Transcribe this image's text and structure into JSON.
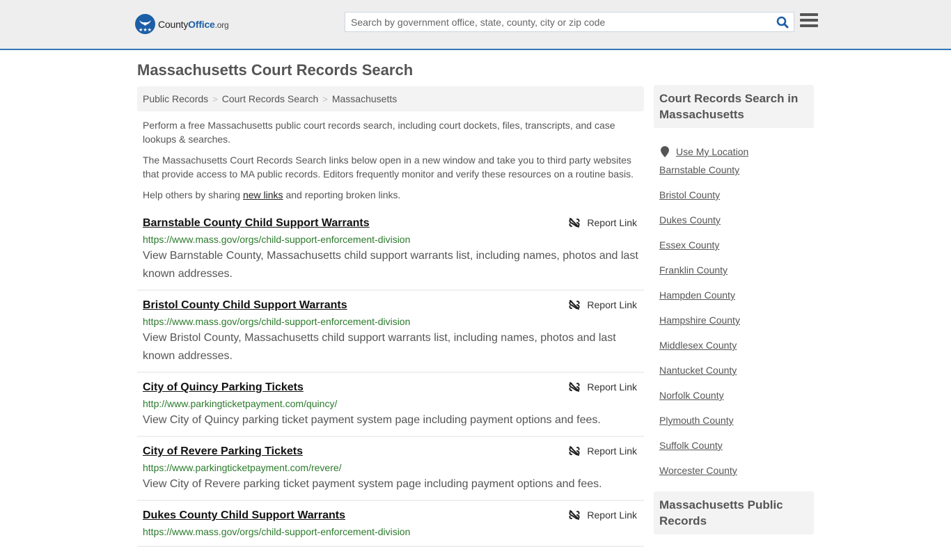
{
  "header": {
    "logo": {
      "county": "County",
      "office": "Office",
      "org": ".org"
    },
    "search": {
      "placeholder": "Search by government office, state, county, city or zip code",
      "value": ""
    },
    "colors": {
      "brand": "#1c5ea6",
      "accent_border": "#3278b6",
      "url_green": "#2b7a2b"
    }
  },
  "page": {
    "title": "Massachusetts Court Records Search"
  },
  "breadcrumb": [
    {
      "label": "Public Records"
    },
    {
      "label": "Court Records Search"
    },
    {
      "label": "Massachusetts"
    }
  ],
  "breadcrumb_separator": ">",
  "intro": {
    "p1": "Perform a free Massachusetts public court records search, including court dockets, files, transcripts, and case lookups & searches.",
    "p2": "The Massachusetts Court Records Search links below open in a new window and take you to third party websites that provide access to MA public records. Editors frequently monitor and verify these resources on a routine basis.",
    "p3_before": "Help others by sharing ",
    "p3_link": "new links",
    "p3_after": " and reporting broken links."
  },
  "report_label": "Report Link",
  "results": [
    {
      "title": "Barnstable County Child Support Warrants",
      "url": "https://www.mass.gov/orgs/child-support-enforcement-division",
      "desc": "View Barnstable County, Massachusetts child support warrants list, including names, photos and last known addresses."
    },
    {
      "title": "Bristol County Child Support Warrants",
      "url": "https://www.mass.gov/orgs/child-support-enforcement-division",
      "desc": "View Bristol County, Massachusetts child support warrants list, including names, photos and last known addresses."
    },
    {
      "title": "City of Quincy Parking Tickets",
      "url": "http://www.parkingticketpayment.com/quincy/",
      "desc": "View City of Quincy parking ticket payment system page including payment options and fees."
    },
    {
      "title": "City of Revere Parking Tickets",
      "url": "https://www.parkingticketpayment.com/revere/",
      "desc": "View City of Revere parking ticket payment system page including payment options and fees."
    },
    {
      "title": "Dukes County Child Support Warrants",
      "url": "https://www.mass.gov/orgs/child-support-enforcement-division",
      "desc": ""
    }
  ],
  "sidebar": {
    "heading1": "Court Records Search in Massachusetts",
    "use_location": "Use My Location",
    "counties": [
      "Barnstable County",
      "Bristol County",
      "Dukes County",
      "Essex County",
      "Franklin County",
      "Hampden County",
      "Hampshire County",
      "Middlesex County",
      "Nantucket County",
      "Norfolk County",
      "Plymouth County",
      "Suffolk County",
      "Worcester County"
    ],
    "heading2": "Massachusetts Public Records"
  }
}
